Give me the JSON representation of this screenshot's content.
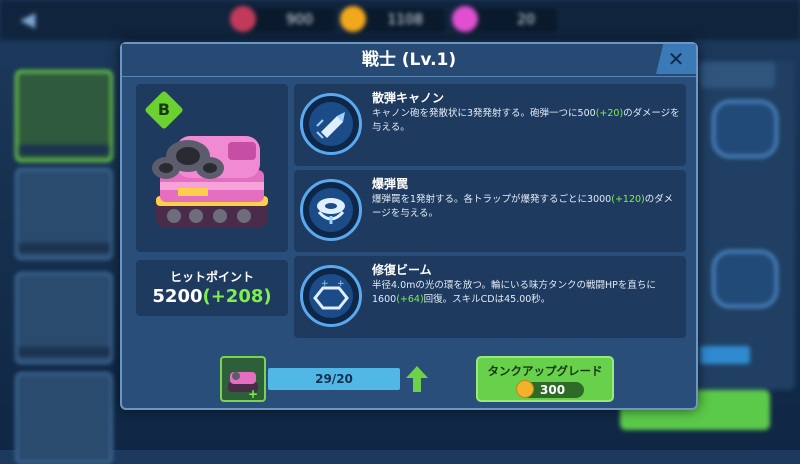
{
  "resources": [
    {
      "name": "parts",
      "value": "900",
      "icon": "gear-parts-icon",
      "color": "#c23a5a"
    },
    {
      "name": "coins",
      "value": "1108",
      "icon": "coin-icon",
      "color": "#f2a81c"
    },
    {
      "name": "gems",
      "value": "20",
      "icon": "gem-icon",
      "color": "#e04fd0"
    }
  ],
  "dialog": {
    "title": "戦士 (Lv.1)",
    "rank": "B",
    "hit_point_label": "ヒットポイント",
    "hit_point_value": "5200",
    "hit_point_bonus": "(+208)",
    "skills": [
      {
        "name": "散弾キャノン",
        "icon": "shotgun-cannon-icon",
        "desc_before": "キャノン砲を発散状に3発発射する。砲弾一つに500",
        "bonus": "(+20)",
        "desc_after": "のダメージを与える。"
      },
      {
        "name": "爆弾罠",
        "icon": "bomb-trap-icon",
        "desc_before": "爆弾罠を1発射する。各トラップが爆発するごとに3000",
        "bonus": "(+120)",
        "desc_after": "のダメージを与える。"
      },
      {
        "name": "修復ビーム",
        "icon": "repair-beam-icon",
        "desc_before": "半径4.0mの光の環を放つ。輪にいる味方タンクの戦闘HPを直ちに1600",
        "bonus": "(+64)",
        "desc_after": "回復。スキルCDは45.00秒。"
      }
    ],
    "progress_text": "29/20",
    "upgrade_label": "タンクアップグレード",
    "upgrade_cost": "300"
  },
  "colors": {
    "accent_green": "#7df04d",
    "dialog_bg": "#2a4e7a",
    "panel_bg": "#1e3a5f",
    "progress_fill": "#51b8e6",
    "button_green": "#68d14c"
  }
}
